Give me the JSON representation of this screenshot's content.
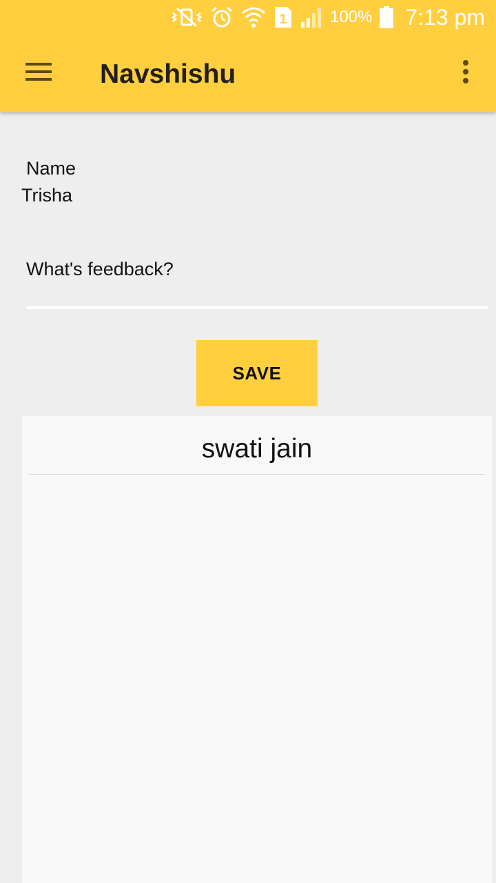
{
  "status_bar": {
    "battery_text": "100%",
    "time": "7:13 pm",
    "icons": [
      "vibrate-off-icon",
      "alarm-icon",
      "wifi-icon",
      "sim-1-icon",
      "signal-icon",
      "battery-icon"
    ]
  },
  "app_bar": {
    "title": "Navshishu",
    "menu_icon": "hamburger-menu-icon",
    "overflow_icon": "more-vert-icon"
  },
  "form": {
    "name_label": "Name",
    "name_value": "Trisha",
    "feedback_placeholder": "What's feedback?",
    "feedback_value": "",
    "save_label": "SAVE"
  },
  "feedback_list": {
    "items": [
      {
        "name": "swati jain"
      }
    ]
  },
  "colors": {
    "accent": "#ffcf40",
    "background": "#eeeeee",
    "card": "#f8f8f8",
    "text": "#111111"
  }
}
